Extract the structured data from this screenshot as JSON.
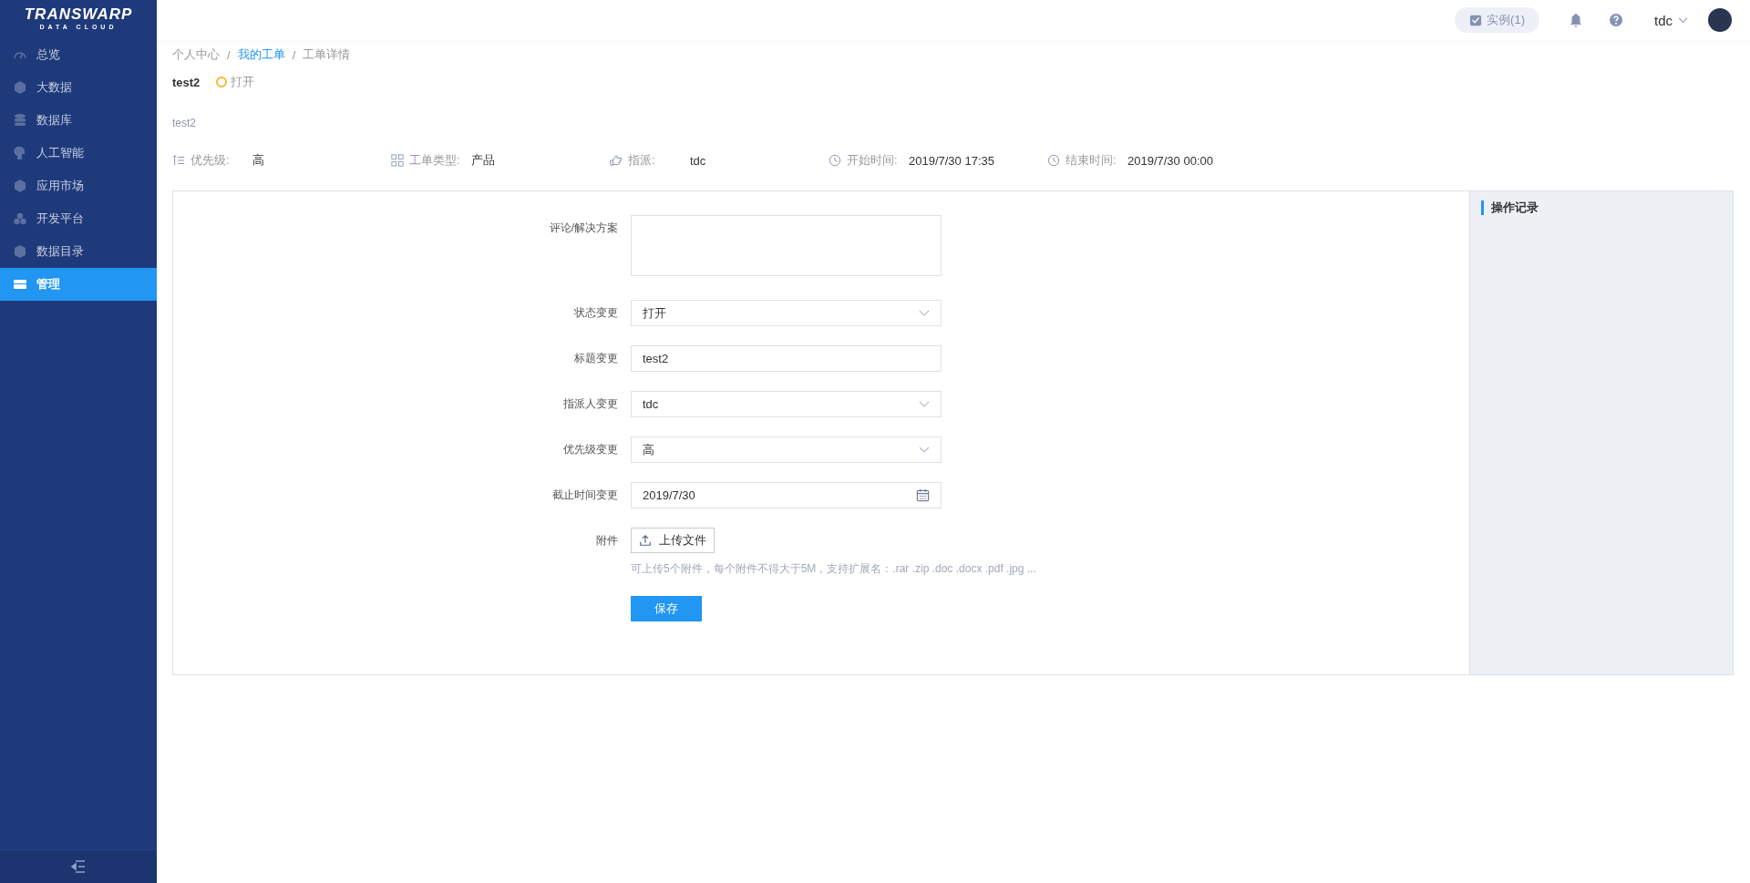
{
  "logo": {
    "title": "TRANSWARP",
    "subtitle": "DATA CLOUD"
  },
  "sidebar": {
    "items": [
      {
        "label": "总览",
        "selected": false
      },
      {
        "label": "大数据",
        "selected": false
      },
      {
        "label": "数据库",
        "selected": false
      },
      {
        "label": "人工智能",
        "selected": false
      },
      {
        "label": "应用市场",
        "selected": false
      },
      {
        "label": "开发平台",
        "selected": false
      },
      {
        "label": "数据目录",
        "selected": false
      },
      {
        "label": "管理",
        "selected": true
      }
    ]
  },
  "header": {
    "instances": "实例(1)",
    "user": "tdc"
  },
  "breadcrumb": {
    "separator": "/",
    "items": [
      {
        "label": "个人中心",
        "link": false
      },
      {
        "label": "我的工单",
        "link": true
      },
      {
        "label": "工单详情",
        "link": false
      }
    ]
  },
  "ticket": {
    "title": "test2",
    "status": "打开",
    "description": "test2"
  },
  "meta": [
    {
      "label": "优先级:",
      "value": "高"
    },
    {
      "label": "工单类型:",
      "value": "产品"
    },
    {
      "label": "指派:",
      "value": "tdc"
    },
    {
      "label": "开始时间:",
      "value": "2019/7/30 17:35"
    },
    {
      "label": "结束时间:",
      "value": "2019/7/30 00:00"
    }
  ],
  "form": {
    "fields": [
      {
        "kind": "textarea",
        "label": "评论/解决方案"
      },
      {
        "kind": "select",
        "label": "状态变更",
        "value": "打开"
      },
      {
        "kind": "input",
        "label": "标题变更",
        "value": "test2"
      },
      {
        "kind": "select",
        "label": "指派人变更",
        "value": "tdc"
      },
      {
        "kind": "select",
        "label": "优先级变更",
        "value": "高"
      },
      {
        "kind": "date",
        "label": "截止时间变更",
        "value": "2019/7/30"
      },
      {
        "kind": "upload",
        "label": "附件",
        "button": "上传文件",
        "hint": "可上传5个附件，每个附件不得大于5M，支持扩展名：.rar .zip .doc .docx .pdf .jpg ..."
      }
    ],
    "submit": "保存"
  },
  "log_panel": {
    "title": "操作记录"
  }
}
